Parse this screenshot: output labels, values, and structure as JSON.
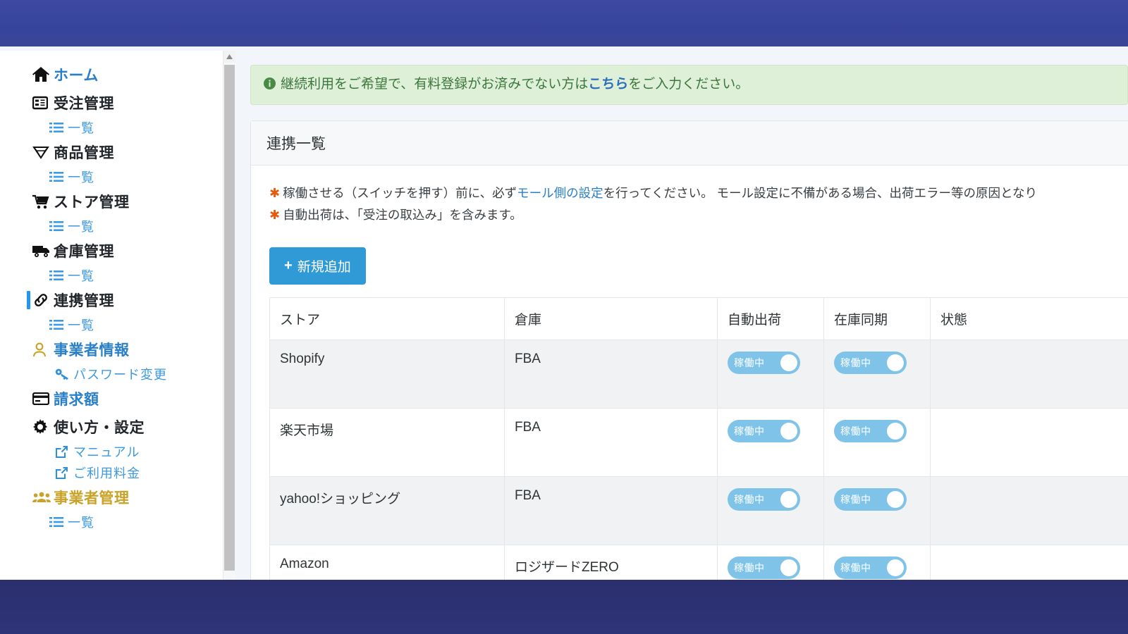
{
  "theme": {
    "topbar_color": "#3a48a0",
    "bottombar_color": "#2c3173",
    "accent_blue": "#2f9ad6",
    "link_blue": "#2a7fc9",
    "gold": "#c9a227",
    "alert_bg": "#dff0d8",
    "alert_text": "#3c763d",
    "toggle_on": "#7fc4e8"
  },
  "sidebar": {
    "items": [
      {
        "label": "ホーム",
        "icon": "home-icon",
        "type": "top-link"
      },
      {
        "label": "受注管理",
        "icon": "table-icon",
        "type": "top"
      },
      {
        "label": "一覧",
        "icon": "list-icon",
        "type": "sub"
      },
      {
        "label": "商品管理",
        "icon": "gem-icon",
        "type": "top"
      },
      {
        "label": "一覧",
        "icon": "list-icon",
        "type": "sub"
      },
      {
        "label": "ストア管理",
        "icon": "cart-icon",
        "type": "top"
      },
      {
        "label": "一覧",
        "icon": "list-icon",
        "type": "sub"
      },
      {
        "label": "倉庫管理",
        "icon": "truck-icon",
        "type": "top"
      },
      {
        "label": "一覧",
        "icon": "list-icon",
        "type": "sub"
      },
      {
        "label": "連携管理",
        "icon": "link-icon",
        "type": "top",
        "active": true
      },
      {
        "label": "一覧",
        "icon": "list-icon",
        "type": "sub"
      },
      {
        "label": "事業者情報",
        "icon": "user-icon",
        "type": "top-link"
      },
      {
        "label": "パスワード変更",
        "icon": "key-icon",
        "type": "sub"
      },
      {
        "label": "請求額",
        "icon": "credit-card-icon",
        "type": "top-link"
      },
      {
        "label": "使い方・設定",
        "icon": "gear-icon",
        "type": "top"
      },
      {
        "label": "マニュアル",
        "icon": "external-link-icon",
        "type": "sub"
      },
      {
        "label": "ご利用料金",
        "icon": "external-link-icon",
        "type": "sub"
      },
      {
        "label": "事業者管理",
        "icon": "users-icon",
        "type": "top-gold"
      },
      {
        "label": "一覧",
        "icon": "list-icon",
        "type": "sub"
      }
    ]
  },
  "alert": {
    "icon": "info-circle-icon",
    "text_before": "継続利用をご希望で、有料登録がお済みでない方は",
    "link_text": "こちら",
    "text_after": "をご入力ください。"
  },
  "panel": {
    "title": "連携一覧",
    "notes": [
      {
        "marker": "✱",
        "text_before": "稼働させる（スイッチを押す）前に、必ず",
        "link_text": "モール側の設定",
        "text_after": "を行ってください。 モール設定に不備がある場合、出荷エラー等の原因となり"
      },
      {
        "marker": "✱",
        "text_before": "自動出荷は、「受注の取込み」を含みます。",
        "link_text": "",
        "text_after": ""
      }
    ],
    "add_button": {
      "icon": "plus-icon",
      "label": "新規追加"
    },
    "table": {
      "columns": [
        "ストア",
        "倉庫",
        "自動出荷",
        "在庫同期",
        "状態"
      ],
      "rows": [
        {
          "store": "Shopify",
          "warehouse": "FBA",
          "auto_ship": "稼働中",
          "stock_sync": "稼働中",
          "state": ""
        },
        {
          "store": "楽天市場",
          "warehouse": "FBA",
          "auto_ship": "稼働中",
          "stock_sync": "稼働中",
          "state": ""
        },
        {
          "store": "yahoo!ショッピング",
          "warehouse": "FBA",
          "auto_ship": "稼働中",
          "stock_sync": "稼働中",
          "state": ""
        },
        {
          "store": "Amazon",
          "warehouse": "ロジザードZERO",
          "auto_ship": "稼働中",
          "stock_sync": "稼働中",
          "state": ""
        }
      ]
    }
  },
  "scrollbar": {
    "up_arrow": "▲"
  }
}
